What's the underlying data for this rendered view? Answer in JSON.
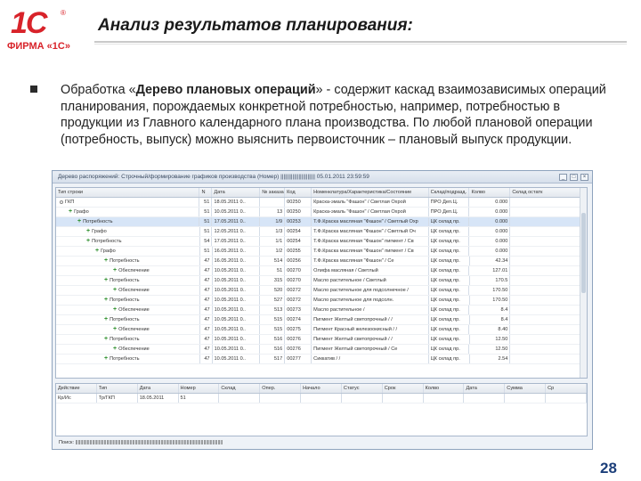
{
  "logo": {
    "mark": "1С",
    "reg": "®",
    "sub": "ФИРМА «1С»"
  },
  "slide": {
    "title": "Анализ результатов планирования:",
    "paragraph_pre": "Обработка «",
    "paragraph_bold": "Дерево плановых операций",
    "paragraph_post": "» - содержит каскад взаимозависимых операций планирования, порождаемых конкретной потребностью, например, потребностью в продукции из Главного календарного плана производства. По любой плановой операции (потребность, выпуск) можно выяснить первоисточник – плановый выпуск продукции.",
    "page_number": "28"
  },
  "window": {
    "title": "Дерево распоряжений: Строчный/формирование графиков производства (Номер) ||||||||||||||||||||||| 05.01.2011 23:59:59",
    "top_grid": {
      "headers": [
        "Тип строки",
        "N",
        "Дата",
        "№ заказа",
        "Код",
        "Номенклатура/Характеристика/Состояние",
        "Склад/подразд.",
        "Колво",
        "Склад остатк"
      ],
      "rows": [
        {
          "indent": 0,
          "icon": "dot",
          "label": "ГКП",
          "n": "51",
          "date": "18.05.2011 0..",
          "num": "",
          "kod": "00250",
          "nom": "Краска-эмаль \"Фашон\" / Светлая Охрой",
          "sklad": "ПРО Деп.Ц.",
          "qty": "0.000",
          "last": ""
        },
        {
          "indent": 1,
          "icon": "plus",
          "label": "Графо",
          "n": "51",
          "date": "10.05.2011 0..",
          "num": "13",
          "kod": "00250",
          "nom": "Краска-эмаль \"Фашон\" / Светлая Охрой",
          "sklad": "ПРО Деп.Ц.",
          "qty": "0.000",
          "last": ""
        },
        {
          "indent": 2,
          "icon": "plus",
          "label": "Потребность",
          "n": "51",
          "date": "17.05.2011 0..",
          "num": "1/9",
          "kod": "00253",
          "nom": "Т.Ф.Краска масляная \"Фашон\" / Светлый Охр",
          "sklad": "ЦК склад пр.",
          "qty": "0.000",
          "last": "",
          "selected": true
        },
        {
          "indent": 3,
          "icon": "plus",
          "label": "Графо",
          "n": "51",
          "date": "12.05.2011 0..",
          "num": "1/3",
          "kod": "00254",
          "nom": "Т.Ф.Краска масляная \"Фашон\" / Светлый Оч",
          "sklad": "ЦК склад пр.",
          "qty": "0.000",
          "last": ""
        },
        {
          "indent": 3,
          "icon": "plus",
          "label": "Потребность",
          "n": "54",
          "date": "17.05.2011 0..",
          "num": "1/1",
          "kod": "00254",
          "nom": "Т.Ф.Краска масляная \"Фашон\" пигмент / Св",
          "sklad": "ЦК склад пр.",
          "qty": "0.000",
          "last": ""
        },
        {
          "indent": 4,
          "icon": "plus",
          "label": "Графо",
          "n": "51",
          "date": "16.05.2011 0..",
          "num": "1/2",
          "kod": "00255",
          "nom": "Т.Ф.Краска масляная \"Фашон\" пигмент / Св",
          "sklad": "ЦК склад пр.",
          "qty": "0.000",
          "last": ""
        },
        {
          "indent": 5,
          "icon": "plus",
          "label": "Потребность",
          "n": "47",
          "date": "16.05.2011 0..",
          "num": "514",
          "kod": "00256",
          "nom": "Т.Ф.Краска масляная \"Фашон\" / Се",
          "sklad": "ЦК склад пр.",
          "qty": "42.34",
          "last": ""
        },
        {
          "indent": 6,
          "icon": "plus",
          "label": "Обеспечение",
          "n": "47",
          "date": "10.05.2011 0..",
          "num": "51",
          "kod": "00270",
          "nom": "Олифа масляная / Светлый",
          "sklad": "ЦК склад пр.",
          "qty": "127.01",
          "last": ""
        },
        {
          "indent": 5,
          "icon": "plus",
          "label": "Потребность",
          "n": "47",
          "date": "10.05.2011 0..",
          "num": "315",
          "kod": "00270",
          "nom": "Масло растительное / Светлый",
          "sklad": "ЦК склад пр.",
          "qty": "170.5",
          "last": ""
        },
        {
          "indent": 6,
          "icon": "plus",
          "label": "Обеспечение",
          "n": "47",
          "date": "10.05.2011 0..",
          "num": "520",
          "kod": "00272",
          "nom": "Масло растительное для подсолнечное / ",
          "sklad": "ЦК склад пр.",
          "qty": "170.50",
          "last": ""
        },
        {
          "indent": 5,
          "icon": "plus",
          "label": "Потребность",
          "n": "47",
          "date": "10.05.2011 0..",
          "num": "527",
          "kod": "00272",
          "nom": "Масло растительное для подсолн.",
          "sklad": "ЦК склад пр.",
          "qty": "170.50",
          "last": ""
        },
        {
          "indent": 6,
          "icon": "plus",
          "label": "Обеспечение",
          "n": "47",
          "date": "10.05.2011 0..",
          "num": "513",
          "kod": "00273",
          "nom": "Масло растительное / ",
          "sklad": "ЦК склад пр.",
          "qty": "8.4",
          "last": ""
        },
        {
          "indent": 5,
          "icon": "plus",
          "label": "Потребность",
          "n": "47",
          "date": "10.05.2011 0..",
          "num": "515",
          "kod": "00274",
          "nom": "Пигмент Желтый светопрочный / /",
          "sklad": "ЦК склад пр.",
          "qty": "8.4",
          "last": ""
        },
        {
          "indent": 6,
          "icon": "plus",
          "label": "Обеспечение",
          "n": "47",
          "date": "10.05.2011 0..",
          "num": "515",
          "kod": "00275",
          "nom": "Пигмент Красный железоокисный / /",
          "sklad": "ЦК склад пр.",
          "qty": "8.40",
          "last": ""
        },
        {
          "indent": 5,
          "icon": "plus",
          "label": "Потребность",
          "n": "47",
          "date": "10.05.2011 0..",
          "num": "516",
          "kod": "00276",
          "nom": "Пигмент Желтый светопрочный / /",
          "sklad": "ЦК склад пр.",
          "qty": "12.50",
          "last": ""
        },
        {
          "indent": 6,
          "icon": "plus",
          "label": "Обеспечение",
          "n": "47",
          "date": "10.05.2011 0..",
          "num": "516",
          "kod": "00276",
          "nom": "Пигмент Желтый светопрочный / Се",
          "sklad": "ЦК склад пр.",
          "qty": "12.50",
          "last": ""
        },
        {
          "indent": 5,
          "icon": "plus",
          "label": "Потребность",
          "n": "47",
          "date": "10.05.2011 0..",
          "num": "517",
          "kod": "00277",
          "nom": "Сиккатив / /",
          "sklad": "ЦК склад пр.",
          "qty": "2.54",
          "last": ""
        }
      ]
    },
    "bottom_grid": {
      "headers": [
        "Действие",
        "Тип",
        "Дата",
        "Номер",
        "Склад",
        "Опер.",
        "Начало",
        "Статус",
        "Срок",
        "Колво",
        "Дата",
        "Сумма",
        "Ср"
      ],
      "row": [
        "Кр/Ис",
        "Тр/ГКП",
        "18.05.2011",
        "51",
        "",
        "",
        "",
        "",
        "",
        "",
        "",
        "",
        ""
      ]
    },
    "status": "Поиск:   ||||||||||||||||||||||||||||||||||||||||||||||||||||||||||||||||||||||||||||||||||||||||||||||||||||||||||||||||||"
  }
}
